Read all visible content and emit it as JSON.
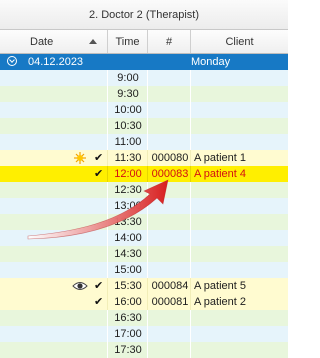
{
  "window": {
    "title": "2. Doctor 2 (Therapist)"
  },
  "columns": {
    "date": "Date",
    "time": "Time",
    "number": "#",
    "client": "Client"
  },
  "group": {
    "date": "04.12.2023",
    "day": "Monday"
  },
  "rows": [
    {
      "time": "9:00"
    },
    {
      "time": "9:30"
    },
    {
      "time": "10:00"
    },
    {
      "time": "10:30"
    },
    {
      "time": "11:00"
    },
    {
      "time": "11:30",
      "number": "000080",
      "client": "A patient 1",
      "icon": "sun-icon",
      "checked": true
    },
    {
      "time": "12:00",
      "number": "000083",
      "client": "A patient 4",
      "checked": true,
      "current": true
    },
    {
      "time": "12:30"
    },
    {
      "time": "13:00"
    },
    {
      "time": "13:30"
    },
    {
      "time": "14:00"
    },
    {
      "time": "14:30"
    },
    {
      "time": "15:00"
    },
    {
      "time": "15:30",
      "number": "000084",
      "client": "A patient 5",
      "icon": "eye-icon",
      "checked": true
    },
    {
      "time": "16:00",
      "number": "000081",
      "client": "A patient 2",
      "checked": true
    },
    {
      "time": "16:30"
    },
    {
      "time": "17:00"
    },
    {
      "time": "17:30"
    }
  ],
  "colors": {
    "group_bg": "#1779c5",
    "current_bg": "#ffef00",
    "current_text": "#d31111",
    "booked_bg": "#fffbd0",
    "arrow": "#d81e1e"
  }
}
